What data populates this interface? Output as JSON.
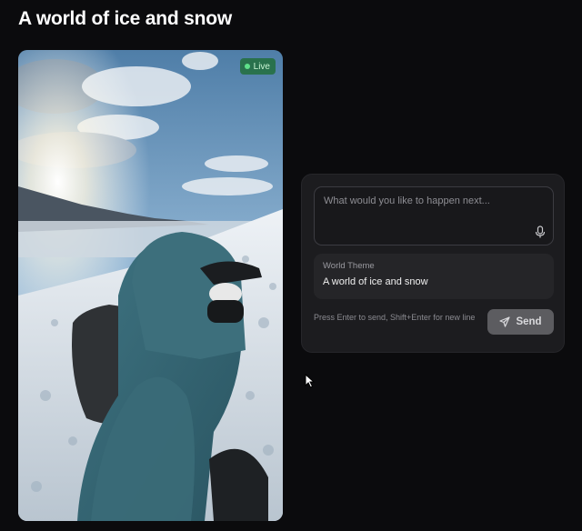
{
  "page": {
    "title": "A world of ice and snow"
  },
  "video": {
    "live_label": "Live"
  },
  "prompt": {
    "placeholder": "What would you like to happen next...",
    "value": "",
    "mic_icon": "microphone-icon"
  },
  "theme": {
    "label": "World Theme",
    "value": "A world of ice and snow"
  },
  "footer": {
    "hint": "Press Enter to send, Shift+Enter for new line",
    "send_label": "Send",
    "send_icon": "paper-plane-icon"
  },
  "colors": {
    "background": "#0b0b0d",
    "panel": "#1c1c1f",
    "live_badge": "#226e3c",
    "send_button": "#5c5c60"
  }
}
